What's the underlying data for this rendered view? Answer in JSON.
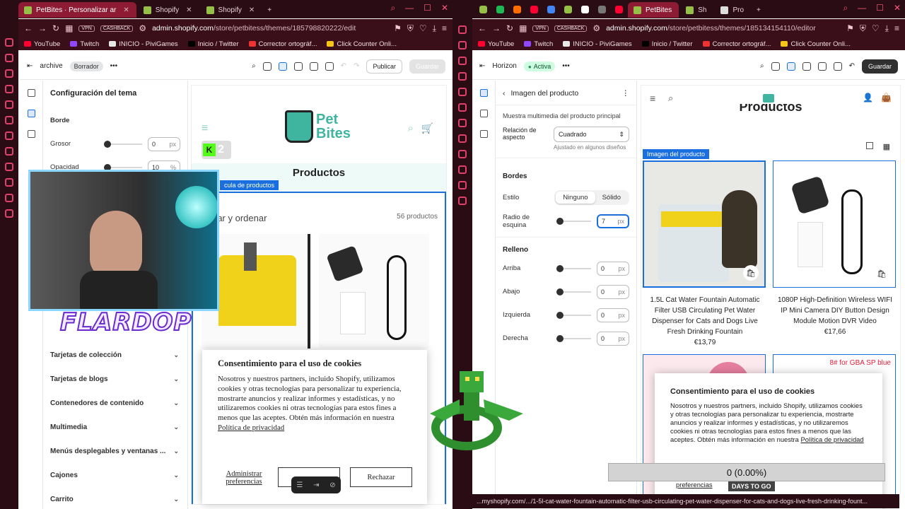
{
  "left": {
    "tabs": [
      {
        "label": "PetBites · Personalizar ar"
      },
      {
        "label": "Shopify"
      },
      {
        "label": "Shopify"
      }
    ],
    "vpn": "VPN",
    "cashback": "CASHBACK",
    "url_host": "admin.shopify.com",
    "url_path": "/store/petbitess/themes/185798820222/edit",
    "theme_name": "archive",
    "theme_status": "Borrador",
    "publish": "Publicar",
    "save": "Guardar",
    "panel_title": "Configuración del tema",
    "border_title": "Borde",
    "grosor_label": "Grosor",
    "grosor_value": "0",
    "opacidad_label": "Opacidad",
    "opacidad_value": "10",
    "unit_px": "px",
    "unit_pct": "%",
    "sections": [
      "Tarjetas de colección",
      "Tarjetas de blogs",
      "Contenedores de contenido",
      "Multimedia",
      "Menús desplegables y ventanas ...",
      "Cajones",
      "Carrito"
    ],
    "store_logo_top": "Pet",
    "store_logo_bottom": "Bites",
    "heading": "Productos",
    "block_label": "cula de productos",
    "filter": "rar y ordenar",
    "count": "56 productos",
    "cookie_title": "Consentimiento para el uso de cookies",
    "cookie_text": "Nosotros y nuestros partners, incluido Shopify, utilizamos cookies y otras tecnologías para personalizar tu experiencia, mostrarte anuncios y realizar informes y estadísticas, y no utilizaremos cookies ni otras tecnologías para estos fines a menos que las aceptes. Obtén más información en nuestra",
    "cookie_link": "Política de privacidad",
    "cookie_manage": "Administrar preferencias",
    "cookie_reject": "Rechazar",
    "overlay_count": "2",
    "overlay_name": "FLARDOP"
  },
  "right": {
    "tabs": [
      {
        "label": "PetBites"
      },
      {
        "label": "Sh"
      },
      {
        "label": "Pro"
      }
    ],
    "vpn": "VPN",
    "cashback": "CASHBACK",
    "url_host": "admin.shopify.com",
    "url_path": "/store/petbitess/themes/185134154110/editor",
    "theme_name": "Horizon",
    "theme_status": "Activa",
    "save": "Guardar",
    "panel_title": "Imagen del producto",
    "media_note": "Muestra multimedia del producto principal",
    "ratio_label": "Relación de aspecto",
    "ratio_value": "Cuadrado",
    "ratio_hint": "Ajustado en algunos diseños",
    "borders_title": "Bordes",
    "style_label": "Estilo",
    "style_none": "Ninguno",
    "style_solid": "Sólido",
    "radius_label": "Radio de esquina",
    "radius_value": "7",
    "padding_title": "Relleno",
    "pad_rows": [
      {
        "label": "Arriba",
        "value": "0"
      },
      {
        "label": "Abajo",
        "value": "0"
      },
      {
        "label": "Izquierda",
        "value": "0"
      },
      {
        "label": "Derecha",
        "value": "0"
      }
    ],
    "unit_px": "px",
    "heading": "Productos",
    "block_label": "Imagen del producto",
    "products": [
      {
        "title": "1.5L Cat Water Fountain Automatic Filter USB Circulating Pet Water Dispenser for Cats and Dogs Live Fresh Drinking Fountain",
        "price": "€13,79"
      },
      {
        "title": "1080P High-Definition Wireless WIFI IP Mini Camera DIY Button Design Module Motion DVR Video",
        "price": "€17,66"
      }
    ],
    "gba_label": "8# for GBA SP blue",
    "cookie_title": "Consentimiento para el uso de cookies",
    "cookie_text": "Nosotros y nuestros partners, incluido Shopify, utilizamos cookies y otras tecnologías para personalizar tu experiencia, mostrarte anuncios y realizar informes y estadísticas, y no utilizaremos cookies ni otras tecnologías para estos fines a menos que las aceptes. Obtén más información en nuestra",
    "cookie_link": "Política de privacidad",
    "cookie_manage": "preferencias",
    "status_url": "...myshopify.com/.../1-5l-cat-water-fountain-automatic-filter-usb-circulating-pet-water-dispenser-for-cats-and-dogs-live-fresh-drinking-fount...",
    "counter": "0 (0.00%)",
    "days_to_go": "DAYS TO GO"
  },
  "bookmarks": [
    "YouTube",
    "Twitch",
    "INICIO - PiviGames",
    "Inicio / Twitter",
    "Corrector ortográf...",
    "Click Counter Onli..."
  ],
  "colors": {
    "accent": "#1a6fe0",
    "browser": "#2a0c14",
    "tab_active": "#8c1b33",
    "pet_teal": "#3fb5a0",
    "pet_yellow": "#f0c419"
  }
}
